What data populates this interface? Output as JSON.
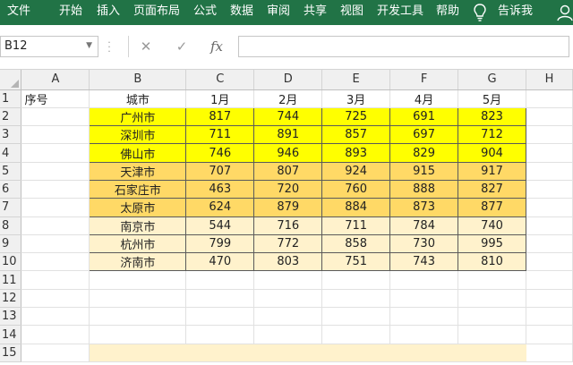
{
  "ribbon": {
    "menu": [
      "文件",
      "开始",
      "插入",
      "页面布局",
      "公式",
      "数据",
      "审阅",
      "共享",
      "视图",
      "开发工具",
      "帮助"
    ],
    "tell_me": "告诉我"
  },
  "formula_bar": {
    "name_box": "B12",
    "cancel_symbol": "✕",
    "enter_symbol": "✓",
    "fx_symbol": "fx",
    "formula_value": ""
  },
  "grid": {
    "columns": [
      "A",
      "B",
      "C",
      "D",
      "E",
      "F",
      "G",
      "H"
    ],
    "row_numbers": [
      "1",
      "2",
      "3",
      "4",
      "5",
      "6",
      "7",
      "8",
      "9",
      "10",
      "11",
      "12",
      "13",
      "14",
      "15"
    ],
    "header_row": {
      "A": "序号",
      "B": "城市",
      "C": "1月",
      "D": "2月",
      "E": "3月",
      "F": "4月",
      "G": "5月"
    },
    "data_rows": [
      {
        "city": "广州市",
        "values": [
          "817",
          "744",
          "725",
          "691",
          "823"
        ],
        "group": "yellow"
      },
      {
        "city": "深圳市",
        "values": [
          "711",
          "891",
          "857",
          "697",
          "712"
        ],
        "group": "yellow"
      },
      {
        "city": "佛山市",
        "values": [
          "746",
          "946",
          "893",
          "829",
          "904"
        ],
        "group": "yellow"
      },
      {
        "city": "天津市",
        "values": [
          "707",
          "807",
          "924",
          "915",
          "917"
        ],
        "group": "orange"
      },
      {
        "city": "石家庄市",
        "values": [
          "463",
          "720",
          "760",
          "888",
          "827"
        ],
        "group": "orange"
      },
      {
        "city": "太原市",
        "values": [
          "624",
          "879",
          "884",
          "873",
          "877"
        ],
        "group": "orange"
      },
      {
        "city": "南京市",
        "values": [
          "544",
          "716",
          "711",
          "784",
          "740"
        ],
        "group": "cream"
      },
      {
        "city": "杭州市",
        "values": [
          "799",
          "772",
          "858",
          "730",
          "995"
        ],
        "group": "cream"
      },
      {
        "city": "济南市",
        "values": [
          "470",
          "803",
          "751",
          "743",
          "810"
        ],
        "group": "cream"
      }
    ]
  },
  "colors": {
    "ribbon": "#217346",
    "yellow": "#ffff00",
    "orange": "#ffd966",
    "cream": "#fff2cc",
    "row15_fill": "#fff2cc"
  }
}
